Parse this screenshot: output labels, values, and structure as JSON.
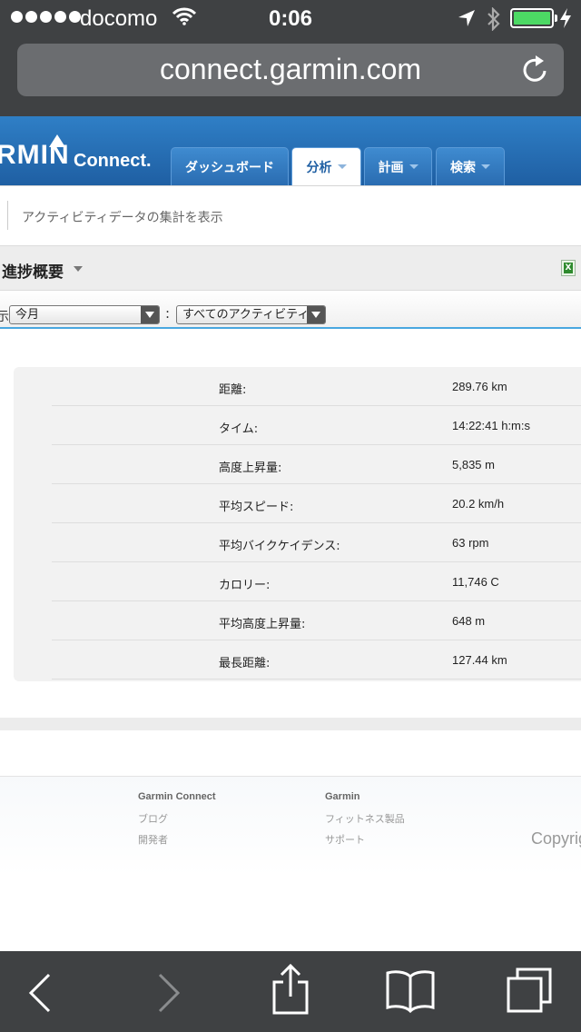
{
  "status": {
    "carrier": "docomo",
    "time": "0:06",
    "battery_color": "#4cd964"
  },
  "browser": {
    "url": "connect.garmin.com"
  },
  "header": {
    "logo_text": "RMIN",
    "logo_sub": "Connect.",
    "tabs": [
      {
        "label": "ダッシュボード",
        "active": false
      },
      {
        "label": "分析",
        "active": true
      },
      {
        "label": "計画",
        "active": false
      },
      {
        "label": "検索",
        "active": false
      }
    ]
  },
  "subheader": {
    "text": "アクティビティデータの集計を表示"
  },
  "section": {
    "title": "進捗概要"
  },
  "filters": {
    "period_label": "示",
    "period_value": "今月",
    "activity_value": "すべてのアクティビティ",
    "separator": ":"
  },
  "stats": [
    {
      "label": "距離:",
      "value": "289.76 km"
    },
    {
      "label": "タイム:",
      "value": "14:22:41 h:m:s"
    },
    {
      "label": "高度上昇量:",
      "value": "5,835 m"
    },
    {
      "label": "平均スピード:",
      "value": "20.2 km/h"
    },
    {
      "label": "平均バイクケイデンス:",
      "value": "63 rpm"
    },
    {
      "label": "カロリー:",
      "value": "11,746 C"
    },
    {
      "label": "平均高度上昇量:",
      "value": "648 m"
    },
    {
      "label": "最長距離:",
      "value": "127.44 km"
    }
  ],
  "footer": {
    "col1_title": "Garmin Connect",
    "col1_links": [
      "ブログ",
      "開発者"
    ],
    "col2_title": "Garmin",
    "col2_links": [
      "フィットネス製品",
      "サポート"
    ],
    "copyright": "Copyrig"
  }
}
